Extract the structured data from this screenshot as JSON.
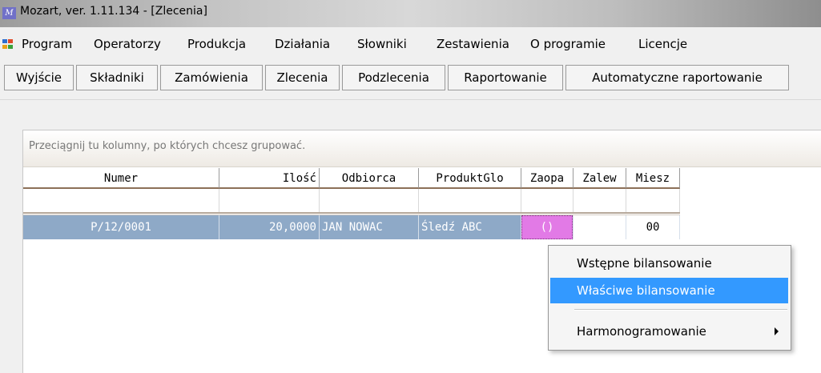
{
  "window": {
    "title": "Mozart, ver. 1.11.134 - [Zlecenia]",
    "icon": "mozart-app-icon"
  },
  "menubar": {
    "icon": "window-menu-icon",
    "items": [
      "Program",
      "Operatorzy",
      "Produkcja",
      "Działania",
      "Słowniki",
      "Zestawienia",
      "O programie",
      "Licencje"
    ]
  },
  "toolbar": {
    "buttons": [
      "Wyjście",
      "Składniki",
      "Zamówienia",
      "Zlecenia",
      "Podzlecenia",
      "Raportowanie",
      "Automatyczne raportowanie"
    ]
  },
  "grid": {
    "group_hint": "Przeciągnij tu kolumny, po których chcesz grupować.",
    "columns": [
      "Numer",
      "Ilość",
      "Odbiorca",
      "ProduktGlo",
      "Zaopa",
      "Zalew",
      "Miesz"
    ],
    "rows": [
      {
        "numer": "P/12/0001",
        "ilosc": "20,0000",
        "odbiorca": "JAN NOWAC",
        "produkt": "Śledź ABC",
        "zaopa": "()",
        "zalew": "",
        "miesz": "00"
      }
    ]
  },
  "context_menu": {
    "items": [
      "Wstępne bilansowanie",
      "Właściwe bilansowanie",
      "Harmonogramowanie"
    ],
    "selected": "Właściwe bilansowanie"
  },
  "colors": {
    "selected_row": "#8ea9c7",
    "zaopa_cell": "#e27ae6",
    "menu_highlight": "#3399ff",
    "header_underline": "#8c7058"
  }
}
